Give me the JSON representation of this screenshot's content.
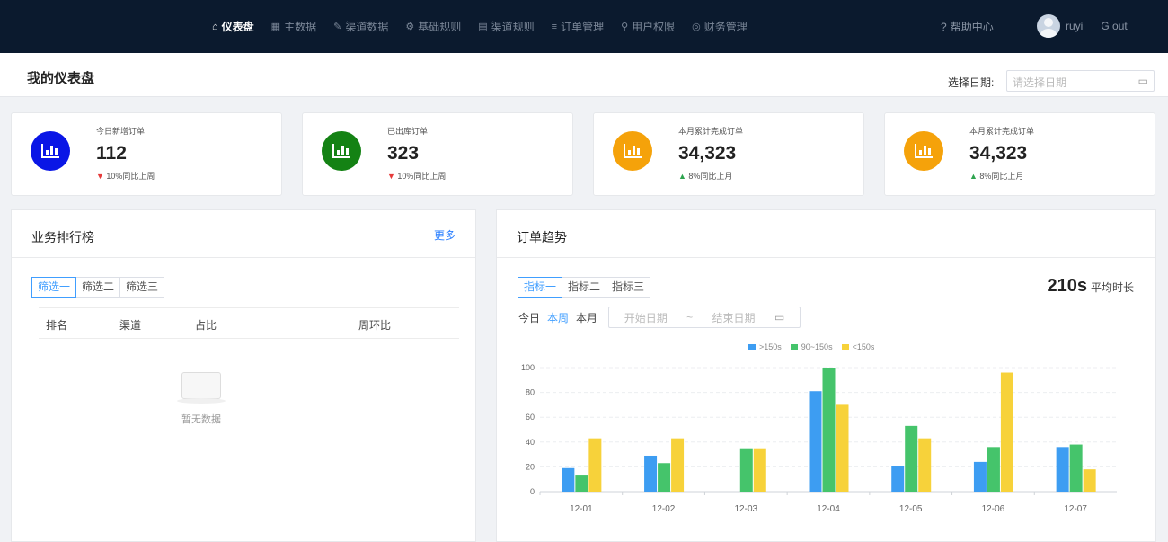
{
  "nav": {
    "items": [
      {
        "icon": "home-icon",
        "glyph": "⌂",
        "label": "仪表盘",
        "active": true
      },
      {
        "icon": "grid-icon",
        "glyph": "▦",
        "label": "主数据",
        "active": false
      },
      {
        "icon": "edit-icon",
        "glyph": "✎",
        "label": "渠道数据",
        "active": false
      },
      {
        "icon": "gear-icon",
        "glyph": "⚙",
        "label": "基础规则",
        "active": false
      },
      {
        "icon": "doc-icon",
        "glyph": "▤",
        "label": "渠道规则",
        "active": false
      },
      {
        "icon": "list-icon",
        "glyph": "≡",
        "label": "订单管理",
        "active": false
      },
      {
        "icon": "user-icon",
        "glyph": "⚲",
        "label": "用户权限",
        "active": false
      },
      {
        "icon": "money-icon",
        "glyph": "◎",
        "label": "财务管理",
        "active": false
      }
    ],
    "help": "帮助中心",
    "username": "ruyi",
    "logout": "out"
  },
  "page": {
    "title": "我的仪表盘",
    "date_label": "选择日期:",
    "date_placeholder": "请选择日期"
  },
  "stats": [
    {
      "label": "今日新增订单",
      "value": "112",
      "delta": "10%同比上周",
      "direction": "down",
      "color": "#0a16e6"
    },
    {
      "label": "已出库订单",
      "value": "323",
      "delta": "10%同比上周",
      "direction": "down",
      "color": "#148214"
    },
    {
      "label": "本月累计完成订单",
      "value": "34,323",
      "delta": "8%同比上月",
      "direction": "up",
      "color": "#f5a20a"
    },
    {
      "label": "本月累计完成订单",
      "value": "34,323",
      "delta": "8%同比上月",
      "direction": "up",
      "color": "#f5a20a"
    }
  ],
  "ranking": {
    "title": "业务排行榜",
    "more": "更多",
    "filters": [
      "筛选一",
      "筛选二",
      "筛选三"
    ],
    "columns": [
      "排名",
      "渠道",
      "占比",
      "周环比"
    ],
    "empty": "暂无数据"
  },
  "trend": {
    "title": "订单趋势",
    "tabs": [
      "指标一",
      "指标二",
      "指标三"
    ],
    "avg_value": "210s",
    "avg_label": "平均时长",
    "periods": [
      "今日",
      "本周",
      "本月"
    ],
    "active_period": 1,
    "start_placeholder": "开始日期",
    "separator": "~",
    "end_placeholder": "结束日期"
  },
  "chart_data": {
    "type": "bar",
    "categories": [
      "12-01",
      "12-02",
      "12-03",
      "12-04",
      "12-05",
      "12-06",
      "12-07"
    ],
    "series": [
      {
        "name": ">150s",
        "color": "#3d9df2",
        "values": [
          19,
          29,
          0,
          81,
          21,
          24,
          36
        ]
      },
      {
        "name": "90~150s",
        "color": "#45c46b",
        "values": [
          13,
          23,
          35,
          100,
          53,
          36,
          38
        ]
      },
      {
        "name": "<150s",
        "color": "#f7d23a",
        "values": [
          43,
          43,
          35,
          70,
          43,
          96,
          18
        ]
      }
    ],
    "ylim": [
      0,
      100
    ],
    "yticks": [
      0,
      20,
      40,
      60,
      80,
      100
    ],
    "grid": true,
    "legend": "top"
  }
}
